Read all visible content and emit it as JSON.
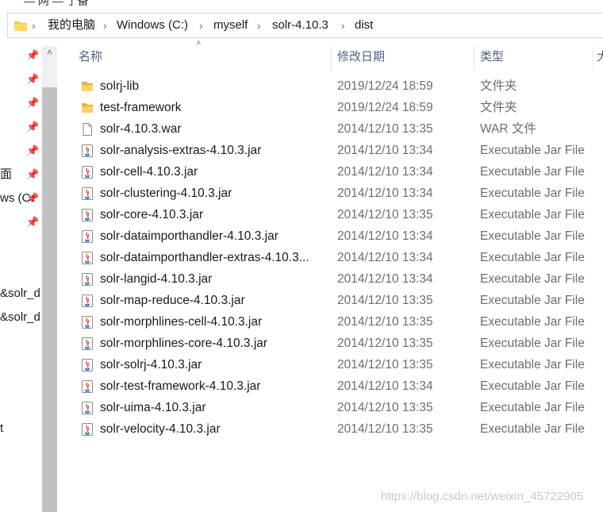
{
  "top_fragment": "— 网 — 了备",
  "breadcrumb": {
    "items": [
      "我的电脑",
      "Windows (C:)",
      "myself",
      "solr-4.10.3",
      "dist"
    ],
    "separator": "›"
  },
  "nav": {
    "scroll_up": "˄",
    "pin": "📌",
    "partial_labels": [
      "面",
      "ws (C:",
      "&solr_d",
      "&solr_d",
      "t"
    ]
  },
  "columns": {
    "sort_indicator": "˄",
    "name": "名称",
    "date": "修改日期",
    "type": "类型",
    "size_partial": "大"
  },
  "files": [
    {
      "name": "solrj-lib",
      "date": "2019/12/24 18:59",
      "type": "文件夹",
      "icon": "folder-icon"
    },
    {
      "name": "test-framework",
      "date": "2019/12/24 18:59",
      "type": "文件夹",
      "icon": "folder-icon"
    },
    {
      "name": "solr-4.10.3.war",
      "date": "2014/12/10 13:35",
      "type": "WAR 文件",
      "icon": "file-icon"
    },
    {
      "name": "solr-analysis-extras-4.10.3.jar",
      "date": "2014/12/10 13:34",
      "type": "Executable Jar File",
      "icon": "java-jar-icon"
    },
    {
      "name": "solr-cell-4.10.3.jar",
      "date": "2014/12/10 13:34",
      "type": "Executable Jar File",
      "icon": "java-jar-icon"
    },
    {
      "name": "solr-clustering-4.10.3.jar",
      "date": "2014/12/10 13:34",
      "type": "Executable Jar File",
      "icon": "java-jar-icon"
    },
    {
      "name": "solr-core-4.10.3.jar",
      "date": "2014/12/10 13:35",
      "type": "Executable Jar File",
      "icon": "java-jar-icon"
    },
    {
      "name": "solr-dataimporthandler-4.10.3.jar",
      "date": "2014/12/10 13:34",
      "type": "Executable Jar File",
      "icon": "java-jar-icon"
    },
    {
      "name": "solr-dataimporthandler-extras-4.10.3...",
      "date": "2014/12/10 13:34",
      "type": "Executable Jar File",
      "icon": "java-jar-icon"
    },
    {
      "name": "solr-langid-4.10.3.jar",
      "date": "2014/12/10 13:34",
      "type": "Executable Jar File",
      "icon": "java-jar-icon"
    },
    {
      "name": "solr-map-reduce-4.10.3.jar",
      "date": "2014/12/10 13:35",
      "type": "Executable Jar File",
      "icon": "java-jar-icon"
    },
    {
      "name": "solr-morphlines-cell-4.10.3.jar",
      "date": "2014/12/10 13:35",
      "type": "Executable Jar File",
      "icon": "java-jar-icon"
    },
    {
      "name": "solr-morphlines-core-4.10.3.jar",
      "date": "2014/12/10 13:35",
      "type": "Executable Jar File",
      "icon": "java-jar-icon"
    },
    {
      "name": "solr-solrj-4.10.3.jar",
      "date": "2014/12/10 13:35",
      "type": "Executable Jar File",
      "icon": "java-jar-icon"
    },
    {
      "name": "solr-test-framework-4.10.3.jar",
      "date": "2014/12/10 13:34",
      "type": "Executable Jar File",
      "icon": "java-jar-icon"
    },
    {
      "name": "solr-uima-4.10.3.jar",
      "date": "2014/12/10 13:35",
      "type": "Executable Jar File",
      "icon": "java-jar-icon"
    },
    {
      "name": "solr-velocity-4.10.3.jar",
      "date": "2014/12/10 13:35",
      "type": "Executable Jar File",
      "icon": "java-jar-icon"
    }
  ],
  "watermark": "https://blog.csdn.net/weixin_45722905",
  "colors": {
    "folder": "#f6c646",
    "header_text": "#4d6082",
    "secondary_text": "#6d6d6d"
  }
}
